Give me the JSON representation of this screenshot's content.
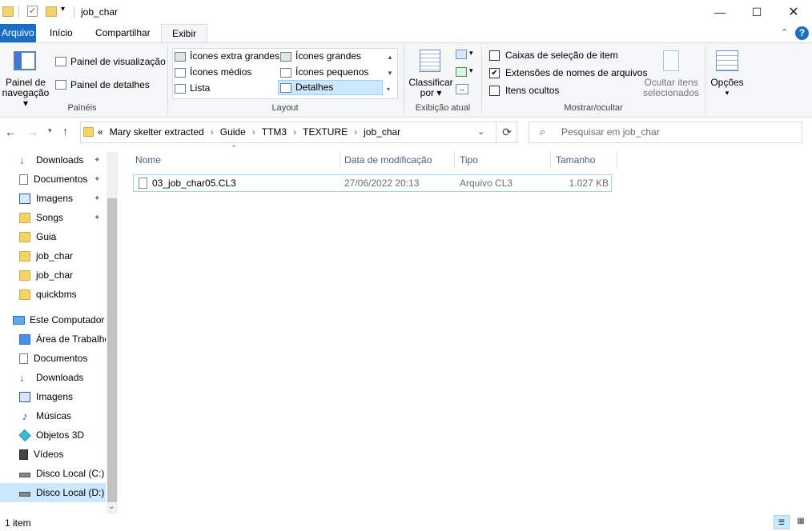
{
  "window": {
    "title": "job_char"
  },
  "ribbon_tabs": [
    "Arquivo",
    "Início",
    "Compartilhar",
    "Exibir"
  ],
  "ribbon": {
    "paineis": {
      "nav_pane_label_1": "Painel de",
      "nav_pane_label_2": "navegação",
      "preview_pane": "Painel de visualização",
      "details_pane": "Painel de detalhes",
      "group": "Painéis"
    },
    "layout": {
      "items": [
        "Ícones extra grandes",
        "Ícones grandes",
        "Ícones médios",
        "Ícones pequenos",
        "Lista",
        "Detalhes"
      ],
      "selected": "Detalhes",
      "group": "Layout"
    },
    "current_view": {
      "sort_label_1": "Classificar",
      "sort_label_2": "por",
      "group": "Exibição atual"
    },
    "show_hide": {
      "item_checkboxes": "Caixas de seleção de item",
      "item_checkboxes_checked": false,
      "file_extensions": "Extensões de nomes de arquivos",
      "file_extensions_checked": true,
      "hidden_items": "Itens ocultos",
      "hidden_items_checked": false,
      "hide_selected_1": "Ocultar itens",
      "hide_selected_2": "selecionados",
      "group": "Mostrar/ocultar"
    },
    "options": "Opções"
  },
  "address": {
    "overflow": "«",
    "crumbs": [
      "Mary skelter extracted",
      "Guide",
      "TTM3",
      "TEXTURE",
      "job_char"
    ]
  },
  "search": {
    "placeholder": "Pesquisar em job_char"
  },
  "sidebar": {
    "quick_access": [
      "Downloads",
      "Documentos",
      "Imagens",
      "Songs",
      "Guia",
      "job_char",
      "job_char",
      "quickbms"
    ],
    "this_pc": "Este Computador",
    "pc_items": [
      "Área de Trabalho",
      "Documentos",
      "Downloads",
      "Imagens",
      "Músicas",
      "Objetos 3D",
      "Vídeos",
      "Disco Local (C:)",
      "Disco Local (D:)"
    ]
  },
  "columns": {
    "name": "Nome",
    "date": "Data de modificação",
    "type": "Tipo",
    "size": "Tamanho"
  },
  "files": [
    {
      "name": "03_job_char05.CL3",
      "date": "27/06/2022 20:13",
      "type": "Arquivo CL3",
      "size": "1.027 KB"
    }
  ],
  "status": {
    "count": "1 item"
  },
  "colors": {
    "accent": "#1a6fc4",
    "selection": "#cce8ff",
    "folder": "#f4d36b"
  }
}
